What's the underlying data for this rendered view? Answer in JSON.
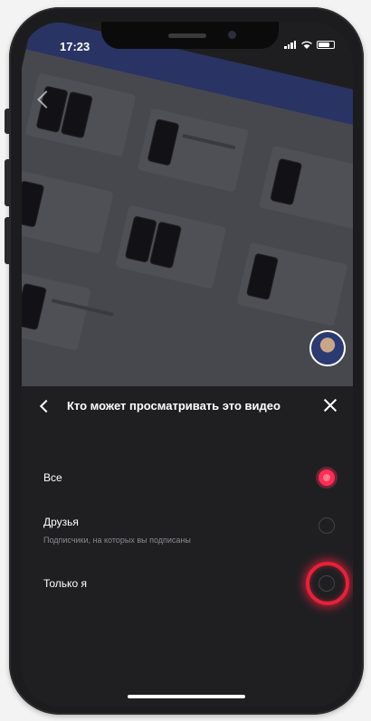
{
  "status_bar": {
    "time": "17:23"
  },
  "privacy_sheet": {
    "title": "Кто может просматривать это видео",
    "options": [
      {
        "label": "Все",
        "sublabel": "",
        "selected": true
      },
      {
        "label": "Друзья",
        "sublabel": "Подписчики, на которых вы подписаны",
        "selected": false
      },
      {
        "label": "Только я",
        "sublabel": "",
        "selected": false,
        "highlighted": true
      }
    ]
  },
  "colors": {
    "accent": "#ff2d55",
    "highlight_ring": "#e6213b",
    "sheet_background": "#1f1f22"
  }
}
